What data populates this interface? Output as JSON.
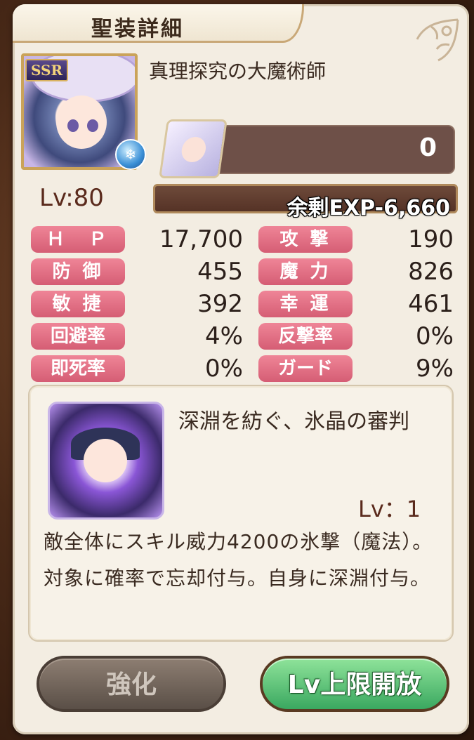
{
  "window": {
    "title": "聖装詳細"
  },
  "equipment": {
    "name": "真理探究の大魔術師",
    "rarity": "SSR",
    "material_count": "0",
    "level": "Lv:80",
    "exp_remaining": "余剰EXP-6,660"
  },
  "stats": [
    {
      "label": "Ｈ　Ｐ",
      "value": "17,700"
    },
    {
      "label": "攻 撃",
      "value": "190"
    },
    {
      "label": "防 御",
      "value": "455"
    },
    {
      "label": "魔 力",
      "value": "826"
    },
    {
      "label": "敏 捷",
      "value": "392"
    },
    {
      "label": "幸 運",
      "value": "461"
    },
    {
      "label": "回避率",
      "value": "4%"
    },
    {
      "label": "反撃率",
      "value": "0%"
    },
    {
      "label": "即死率",
      "value": "0%"
    },
    {
      "label": "ガード",
      "value": "9%"
    }
  ],
  "skill": {
    "name": "深淵を紡ぐ、氷晶の審判",
    "level": "Lv：1",
    "description": "敵全体にスキル威力4200の氷撃（魔法）。対象に確率で忘却付与。自身に深淵付与。"
  },
  "buttons": {
    "enhance": "強化",
    "limit_break": "Lv上限開放"
  },
  "icons": {
    "element": "ice-element-icon",
    "corner": "ornament-corner-icon"
  },
  "colors": {
    "stat_label": "#e07388",
    "panel": "#f3ede2",
    "limit_button": "#5cc878"
  }
}
